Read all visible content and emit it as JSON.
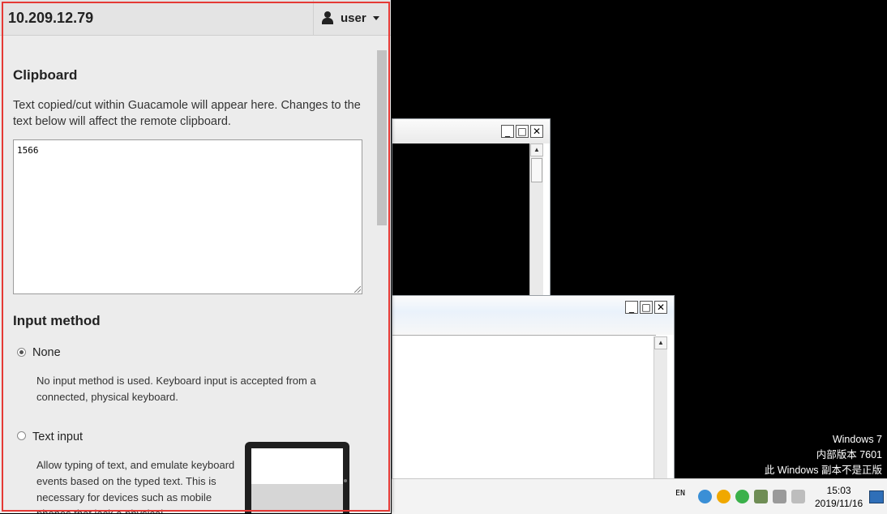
{
  "panel": {
    "host": "10.209.12.79",
    "user": "user",
    "clipboard": {
      "heading": "Clipboard",
      "description": "Text copied/cut within Guacamole will appear here. Changes to the text below will affect the remote clipboard.",
      "value": "1566"
    },
    "input_method": {
      "heading": "Input method",
      "options": [
        {
          "label": "None",
          "checked": true,
          "description": "No input method is used. Keyboard input is accepted from a connected, physical keyboard."
        },
        {
          "label": "Text input",
          "checked": false,
          "description": "Allow typing of text, and emulate keyboard events based on the typed text. This is necessary for devices such as mobile phones that lack a physical"
        }
      ]
    }
  },
  "remote": {
    "windows_info": [
      "Windows 7",
      "内部版本 7601",
      "此 Windows 副本不是正版"
    ],
    "taskbar": {
      "lang": "EN",
      "time": "15:03",
      "date": "2019/11/16"
    },
    "window_buttons": [
      "_",
      "□",
      "✕"
    ]
  },
  "colors": {
    "panel_bg": "#ececec",
    "focus_outline": "#e53935",
    "desktop_bg": "#000000"
  }
}
